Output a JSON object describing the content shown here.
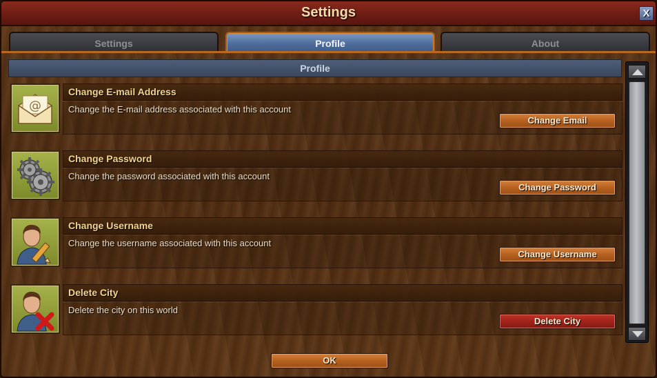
{
  "window": {
    "title": "Settings",
    "close_label": "X"
  },
  "tabs": [
    {
      "label": "Settings",
      "active": false
    },
    {
      "label": "Profile",
      "active": true
    },
    {
      "label": "About",
      "active": false
    }
  ],
  "section": {
    "title": "Profile"
  },
  "rows": [
    {
      "title": "Change E-mail Address",
      "description": "Change the E-mail address associated with this account",
      "button": "Change Email",
      "icon": "envelope-icon"
    },
    {
      "title": "Change Password",
      "description": "Change the password associated with this account",
      "button": "Change Password",
      "icon": "gears-icon"
    },
    {
      "title": "Change Username",
      "description": "Change the username associated with this account",
      "button": "Change Username",
      "icon": "user-edit-icon"
    },
    {
      "title": "Delete City",
      "description": "Delete the city on this world",
      "button": "Delete City",
      "icon": "user-delete-icon"
    }
  ],
  "footer": {
    "ok_label": "OK"
  },
  "colors": {
    "title_bar": "#6e1d14",
    "active_tab": "#4e6d9c",
    "button_orange": "#b6611f",
    "button_red": "#a0231a",
    "row_title_text": "#f4d48e"
  }
}
